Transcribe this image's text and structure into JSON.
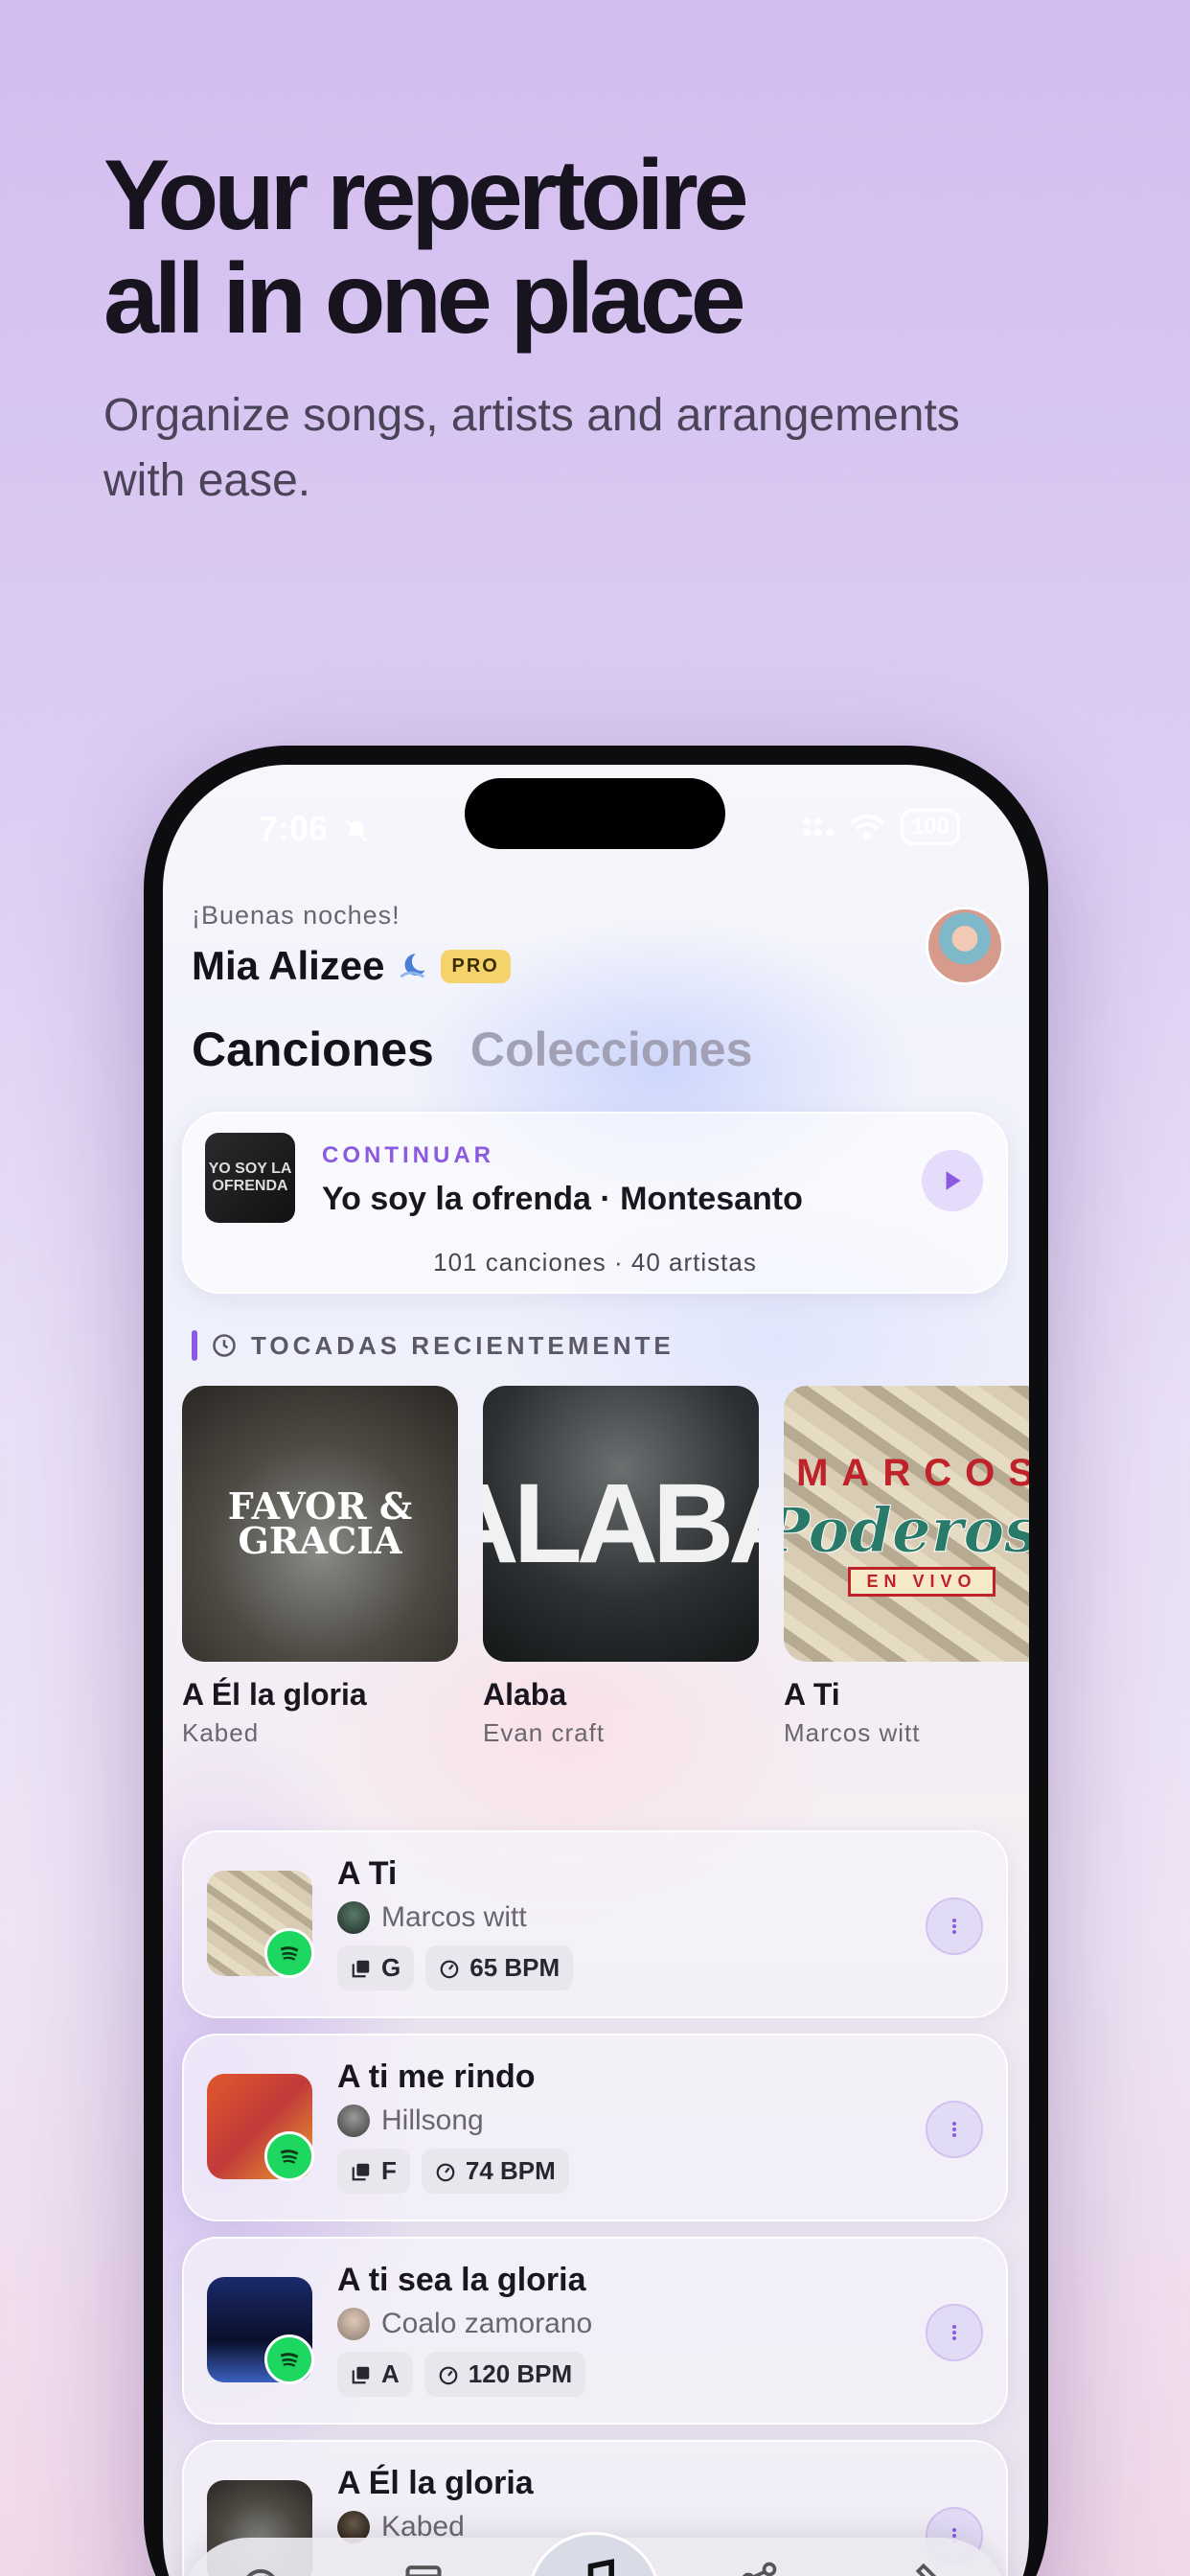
{
  "promo": {
    "title_line1": "Your repertoire",
    "title_line2": "all in one place",
    "subtitle": "Organize songs, artists and arrangements with ease."
  },
  "status_bar": {
    "time": "7:06",
    "battery": "100"
  },
  "header": {
    "greeting": "¡Buenas noches!",
    "username": "Mia Alizee",
    "badge": "PRO"
  },
  "tabs": [
    {
      "label": "Canciones",
      "active": true
    },
    {
      "label": "Colecciones",
      "active": false
    }
  ],
  "continue_card": {
    "label": "CONTINUAR",
    "title": "Yo soy la ofrenda · Montesanto",
    "stats": "101 canciones · 40 artistas",
    "cover_text": "YO SOY LA OFRENDA"
  },
  "recent_section": {
    "title": "TOCADAS RECIENTEMENTE"
  },
  "recent": [
    {
      "title": "A Él la gloria",
      "artist": "Kabed",
      "cover_text": "FAVOR & GRACIA"
    },
    {
      "title": "Alaba",
      "artist": "Evan craft",
      "cover_text": "ALABA"
    },
    {
      "title": "A Ti",
      "artist": "Marcos witt",
      "cover_text": "MARCOS",
      "cover_text2": "Poderoso",
      "cover_text3": "EN VIVO"
    }
  ],
  "songs": [
    {
      "title": "A Ti",
      "artist": "Marcos witt",
      "key": "G",
      "bpm": "65 BPM"
    },
    {
      "title": "A ti me rindo",
      "artist": "Hillsong",
      "key": "F",
      "bpm": "74 BPM"
    },
    {
      "title": "A ti sea la gloria",
      "artist": "Coalo zamorano",
      "key": "A",
      "bpm": "120 BPM"
    },
    {
      "title": "A Él la gloria",
      "artist": "Kabed"
    }
  ],
  "colors": {
    "accent": "#8b5ae0",
    "pro_badge": "#f4d36a",
    "spotify": "#1ed760"
  },
  "icons": {
    "status": [
      "bell-off-icon",
      "signal-icon",
      "wifi-icon",
      "battery-icon"
    ],
    "section": "clock-icon",
    "chips": [
      "key-icon",
      "metronome-icon"
    ],
    "tabbar": [
      "dashboard-icon",
      "calendar-icon",
      "music-note-icon",
      "share-icon",
      "tools-icon"
    ]
  }
}
